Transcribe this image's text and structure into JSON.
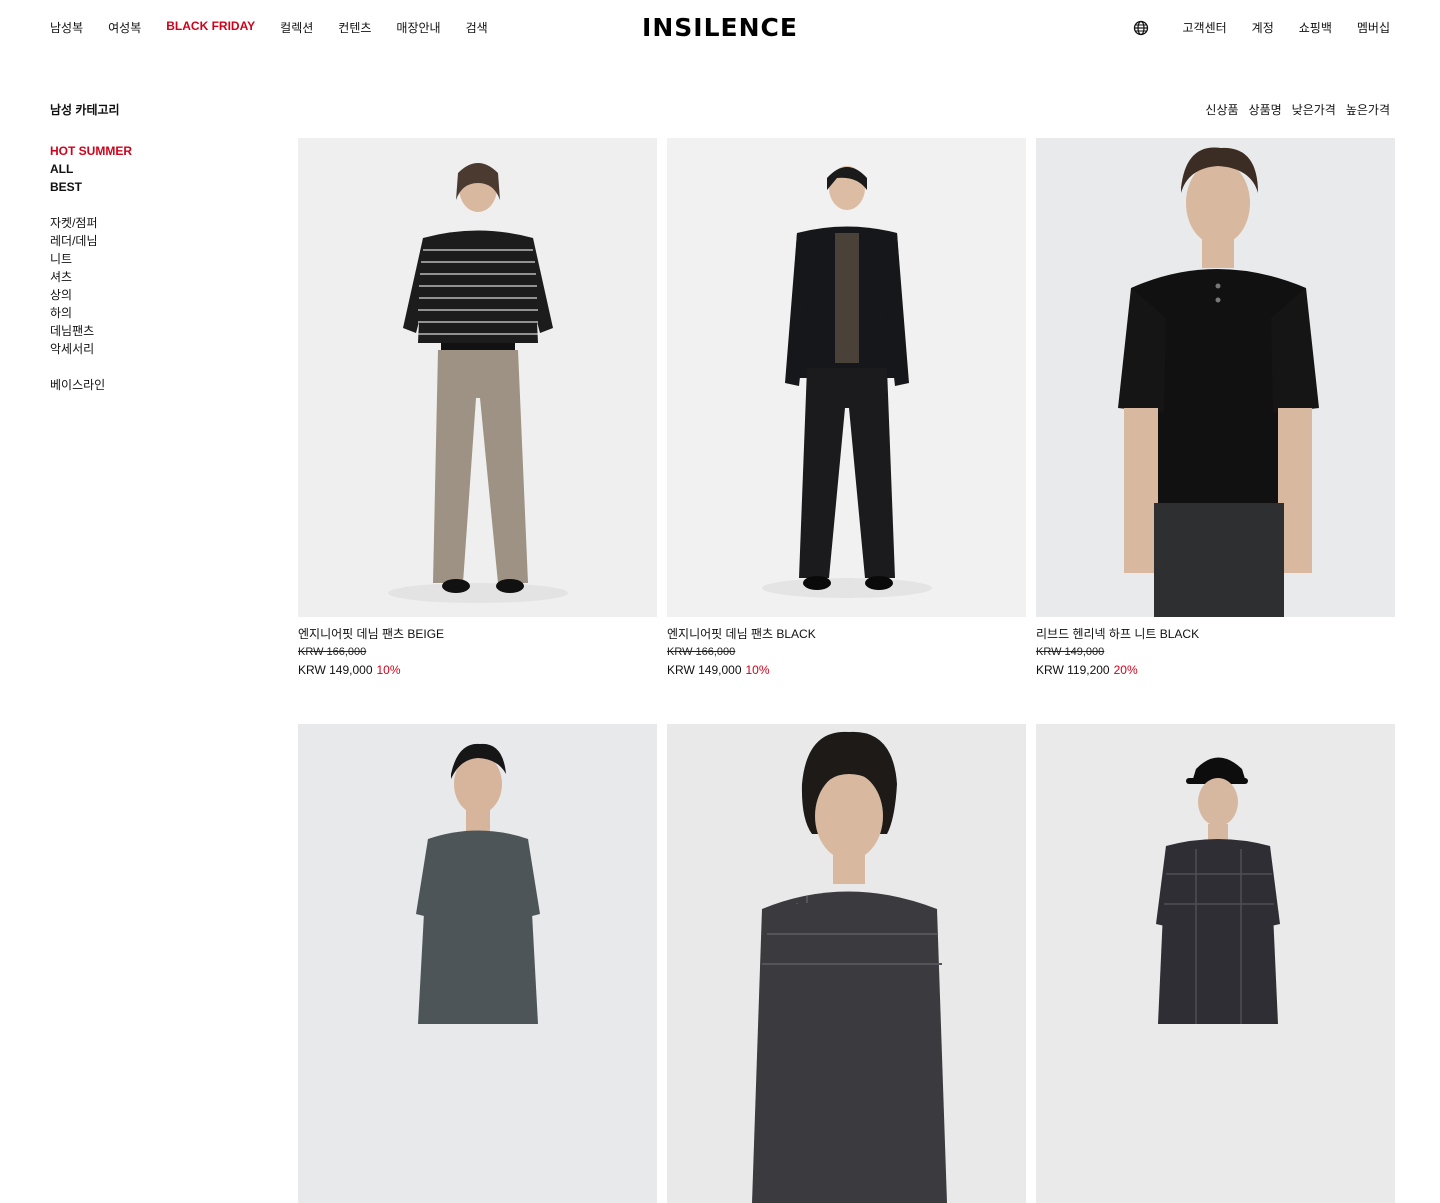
{
  "header": {
    "nav_left": [
      "남성복",
      "여성복",
      "BLACK FRIDAY",
      "컬렉션",
      "컨텐츠",
      "매장안내",
      "검색"
    ],
    "logo": "INSILENCE",
    "nav_right": [
      "고객센터",
      "계정",
      "쇼핑백",
      "멤버십"
    ],
    "icons": {
      "language": "globe-icon"
    },
    "sale_color": "#d0021b"
  },
  "category": {
    "title": "남성 카테고리",
    "featured": [
      "HOT SUMMER",
      "ALL",
      "BEST"
    ],
    "items": [
      "자켓/점퍼",
      "레더/데님",
      "니트",
      "셔츠",
      "상의",
      "하의",
      "데님팬츠",
      "악세서리"
    ],
    "extra": [
      "베이스라인"
    ]
  },
  "sort": [
    "신상품",
    "상품명",
    "낮은가격",
    "높은가격"
  ],
  "products": [
    {
      "name": "엔지니어핏 데님 팬츠 BEIGE",
      "original": "KRW 166,000",
      "price": "KRW 149,000",
      "discount": "10%"
    },
    {
      "name": "엔지니어핏 데님 팬츠 BLACK",
      "original": "KRW 166,000",
      "price": "KRW 149,000",
      "discount": "10%"
    },
    {
      "name": "리브드 헨리넥 하프 니트 BLACK",
      "original": "KRW 149,000",
      "price": "KRW 119,200",
      "discount": "20%"
    },
    {
      "name": "",
      "original": "",
      "price": "",
      "discount": ""
    },
    {
      "name": "",
      "original": "",
      "price": "",
      "discount": ""
    },
    {
      "name": "",
      "original": "",
      "price": "",
      "discount": ""
    }
  ]
}
